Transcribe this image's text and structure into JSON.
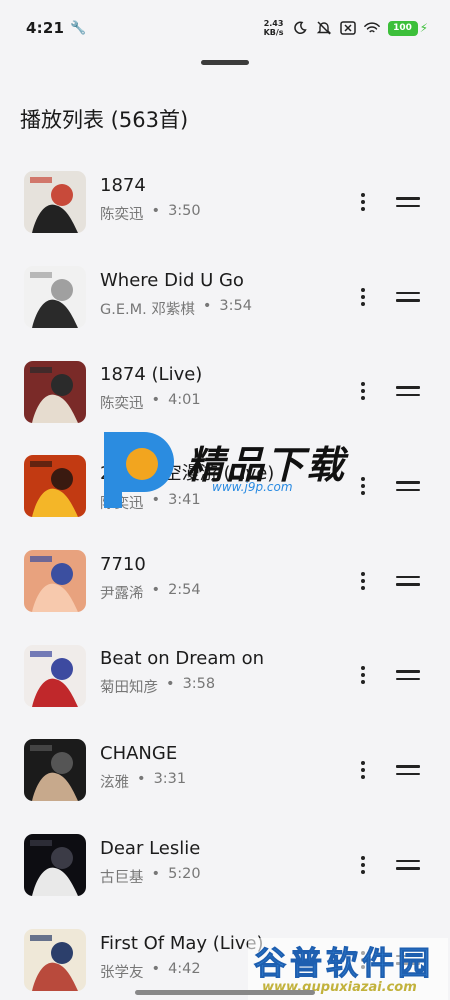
{
  "status_bar": {
    "time": "4:21",
    "net_speed": "2.43",
    "net_unit": "KB/s",
    "battery": "100",
    "battery_color": "#3cbf3a"
  },
  "header": {
    "title": "播放列表 (563首)"
  },
  "songs": [
    {
      "title": "1874",
      "artist": "陈奕迅",
      "duration": "3:50",
      "cover_colors": [
        "#e6e2dc",
        "#222222",
        "#c84a3a"
      ]
    },
    {
      "title": "Where Did U Go",
      "artist": "G.E.M. 邓紫棋",
      "duration": "3:54",
      "cover_colors": [
        "#f1f1f1",
        "#2a2a2a",
        "#a0a0a0"
      ]
    },
    {
      "title": "1874 (Live)",
      "artist": "陈奕迅",
      "duration": "4:01",
      "cover_colors": [
        "#7a2a28",
        "#e6dccf",
        "#2b2b2b"
      ]
    },
    {
      "title": "2001太空漫游 (Live)",
      "artist": "陈奕迅",
      "duration": "3:41",
      "cover_colors": [
        "#c23a12",
        "#f4b628",
        "#3a1a10"
      ]
    },
    {
      "title": "7710",
      "artist": "尹露浠",
      "duration": "2:54",
      "cover_colors": [
        "#e8a27e",
        "#f7c9ad",
        "#3b4fa0"
      ]
    },
    {
      "title": "Beat on Dream on",
      "artist": "菊田知彦",
      "duration": "3:58",
      "cover_colors": [
        "#f0ecea",
        "#c0282b",
        "#3d4aa0"
      ]
    },
    {
      "title": "CHANGE",
      "artist": "泫雅",
      "duration": "3:31",
      "cover_colors": [
        "#1b1b1b",
        "#c7a98c",
        "#555555"
      ]
    },
    {
      "title": "Dear Leslie",
      "artist": "古巨基",
      "duration": "5:20",
      "cover_colors": [
        "#0d0d12",
        "#e9e9e9",
        "#3b3b46"
      ]
    },
    {
      "title": "First Of May (Live)",
      "artist": "张学友",
      "duration": "4:42",
      "cover_colors": [
        "#efe8d8",
        "#b94a3c",
        "#2c3f6b"
      ]
    }
  ],
  "watermark_top": {
    "text": "精品下载",
    "url": "www.j9p.com"
  },
  "watermark_bottom": {
    "text": "谷普软件园",
    "url": "www.gupuxiazai.com"
  }
}
